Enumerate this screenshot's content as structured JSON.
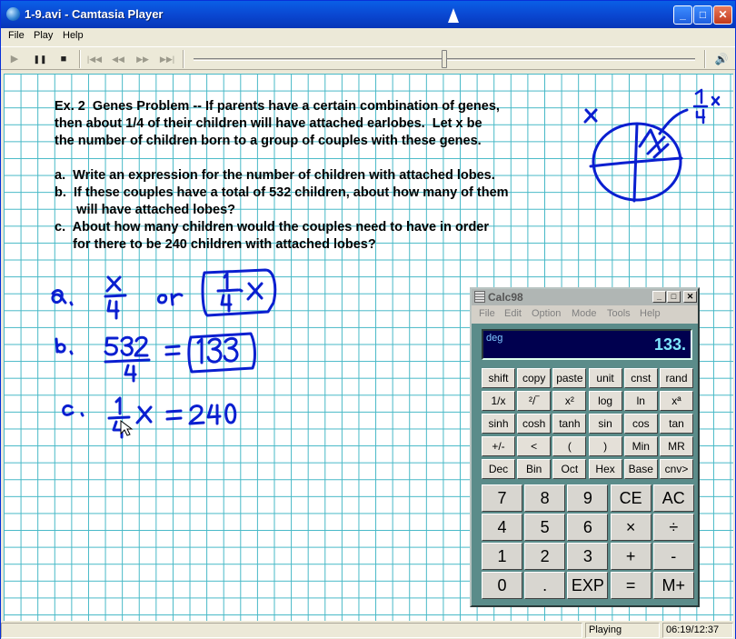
{
  "window": {
    "title": "1-9.avi - Camtasia Player",
    "min": "_",
    "max": "□",
    "close": "✕"
  },
  "menu": [
    "File",
    "Play",
    "Help"
  ],
  "controls": {
    "play": "▶",
    "pause": "❚❚",
    "stop": "■",
    "start": "|◀◀",
    "rewind": "◀◀",
    "forward": "▶▶",
    "end": "▶▶|",
    "volume": "🔊"
  },
  "seek": {
    "position_fraction": 0.5
  },
  "problem": {
    "lines": [
      "Ex. 2  Genes Problem -- If parents have a certain combination of genes,",
      "then about 1/4 of their children will have attached earlobes.  Let x be",
      "the number of children born to a group of couples with these genes.",
      "",
      "a.  Write an expression for the number of children with attached lobes.",
      "b.  If these couples have a total of 532 children, about how many of them",
      "      will have attached lobes?",
      "c.  About how many children would the couples need to have in order",
      "     for there to be 240 children with attached lobes?"
    ]
  },
  "calc": {
    "title": "Calc98",
    "title_buttons": [
      "_",
      "□",
      "✕"
    ],
    "menu": [
      "File",
      "Edit",
      "Option",
      "Mode",
      "Tools",
      "Help"
    ],
    "mode": "deg",
    "display": "133.",
    "func_rows": [
      [
        "shift",
        "copy",
        "paste",
        "unit",
        "cnst",
        "rand"
      ],
      [
        "1/x",
        "²/‾",
        "x²",
        "log",
        "ln",
        "xª"
      ],
      [
        "sinh",
        "cosh",
        "tanh",
        "sin",
        "cos",
        "tan"
      ],
      [
        "+/-",
        "<",
        "(",
        ")",
        "Min",
        "MR"
      ],
      [
        "Dec",
        "Bin",
        "Oct",
        "Hex",
        "Base",
        "cnv>"
      ]
    ],
    "num_rows": [
      [
        "7",
        "8",
        "9",
        "CE",
        "AC"
      ],
      [
        "4",
        "5",
        "6",
        "×",
        "÷"
      ],
      [
        "1",
        "2",
        "3",
        "+",
        "-"
      ],
      [
        "0",
        ".",
        "EXP",
        "=",
        "M+"
      ]
    ]
  },
  "status": {
    "state": "Playing",
    "time": "06:19/12:37"
  },
  "colors": {
    "ink": "#0a1fd0",
    "grid": "#45b8c6",
    "titlebar": "#0a48d2"
  }
}
